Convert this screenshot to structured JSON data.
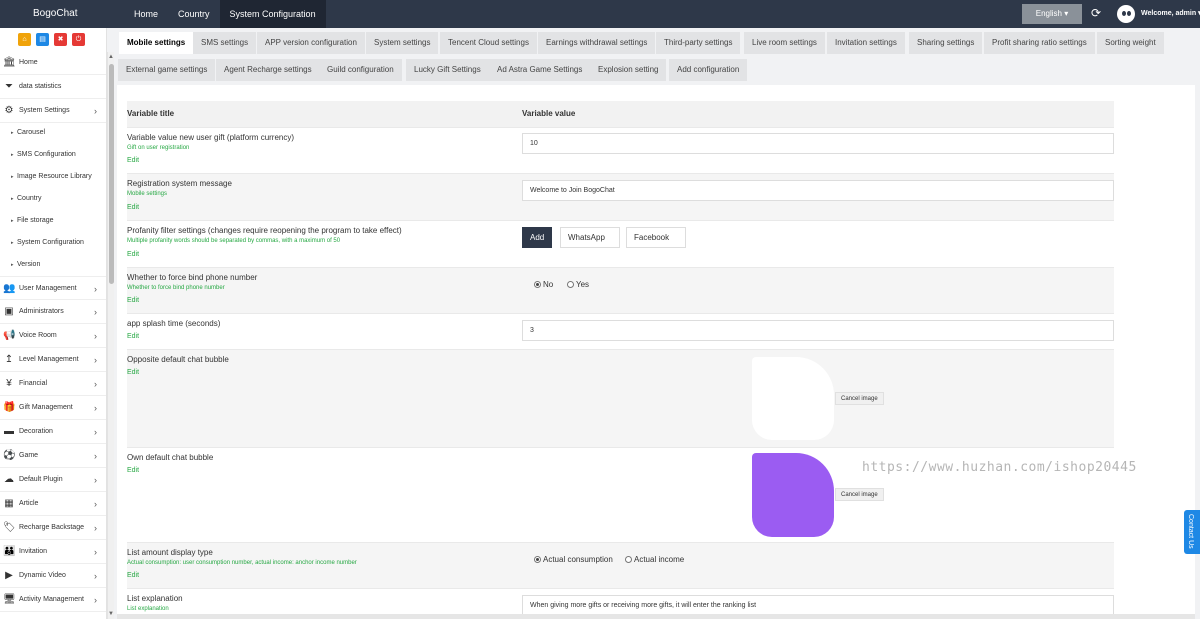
{
  "app": {
    "title": "BogoChat"
  },
  "topnav": {
    "items": [
      "Home",
      "Country",
      "System Configuration"
    ],
    "active": "System Configuration"
  },
  "header": {
    "language": "English ▾",
    "user": "Welcome, admin ▾"
  },
  "colors": {
    "topbar": "#2e3849",
    "accent_green": "#27a844",
    "own_bubble": "#9b5cf2",
    "contact": "#1e88e5"
  },
  "sidebar": {
    "quick_icons": [
      "home-icon",
      "file-icon",
      "trash-icon",
      "power-icon"
    ],
    "items_top": [
      {
        "label": "Home",
        "icon": "bank-icon"
      },
      {
        "label": "data statistics",
        "icon": "filter-icon"
      },
      {
        "label": "System Settings",
        "icon": "gears-icon"
      }
    ],
    "sub_items": [
      "Carousel",
      "SMS Configuration",
      "Image Resource Library",
      "Country",
      "File storage",
      "System Configuration",
      "Version"
    ],
    "items_bottom": [
      {
        "label": "User Management",
        "icon": "users-icon"
      },
      {
        "label": "Administrators",
        "icon": "id-card-icon"
      },
      {
        "label": "Voice Room",
        "icon": "megaphone-icon"
      },
      {
        "label": "Level Management",
        "icon": "level-up-icon"
      },
      {
        "label": "Financial",
        "icon": "yen-icon"
      },
      {
        "label": "Gift Management",
        "icon": "gift-icon"
      },
      {
        "label": "Decoration",
        "icon": "minus-icon"
      },
      {
        "label": "Game",
        "icon": "soccer-ball-icon"
      },
      {
        "label": "Default Plugin",
        "icon": "plugin-icon"
      },
      {
        "label": "Article",
        "icon": "grid-icon"
      },
      {
        "label": "Recharge Backstage",
        "icon": "tag-icon"
      },
      {
        "label": "Invitation",
        "icon": "group-icon"
      },
      {
        "label": "Dynamic Video",
        "icon": "video-icon"
      },
      {
        "label": "Activity Management",
        "icon": "monitor-icon"
      }
    ]
  },
  "tabs": {
    "row1": [
      "Mobile settings",
      "SMS settings",
      "APP version configuration",
      "System settings",
      "Tencent Cloud settings",
      "Earnings withdrawal settings",
      "Third-party settings",
      "Live room settings",
      "Invitation settings",
      "Sharing settings",
      "Profit sharing ratio settings",
      "Sorting weight"
    ],
    "row2": [
      "External game settings",
      "Agent Recharge settings",
      "Guild configuration",
      "Lucky Gift Settings",
      "Ad Astra Game Settings",
      "Explosion setting",
      "Add configuration"
    ],
    "active": "Mobile settings"
  },
  "table": {
    "col_title": "Variable title",
    "col_value": "Variable value",
    "edit_label": "Edit",
    "rows": [
      {
        "title": "Variable value new user gift (platform currency)",
        "desc": "Gift on user registration",
        "value": "10"
      },
      {
        "title": "Registration system message",
        "desc": "Mobile settings",
        "value": "Welcome to Join BogoChat"
      },
      {
        "title": "Profanity filter settings (changes require reopening the program to take effect)",
        "desc": "Multiple profanity words should be separated by commas, with a maximum of 50",
        "add_label": "Add",
        "words": [
          "WhatsApp",
          "Facebook"
        ]
      },
      {
        "title": "Whether to force bind phone number",
        "desc": "Whether to force bind phone number",
        "options": [
          "No",
          "Yes"
        ],
        "selected": "No"
      },
      {
        "title": "app splash time (seconds)",
        "value": "3"
      },
      {
        "title": "Opposite default chat bubble",
        "cancel_label": "Cancel image"
      },
      {
        "title": "Own default chat bubble",
        "cancel_label": "Cancel image"
      },
      {
        "title": "List amount display type",
        "desc": "Actual consumption: user consumption number, actual income: anchor income number",
        "options": [
          "Actual consumption",
          "Actual income"
        ],
        "selected": "Actual consumption"
      },
      {
        "title": "List explanation",
        "desc": "List explanation",
        "value": "When giving more gifts or receiving more gifts, it will enter the ranking list"
      }
    ]
  },
  "watermark": "https://www.huzhan.com/ishop20445",
  "contact": "Contact Us"
}
